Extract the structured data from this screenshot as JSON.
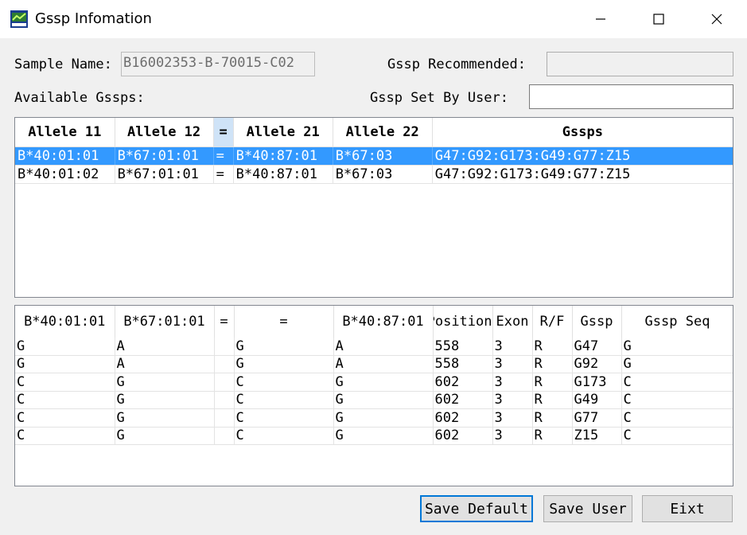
{
  "window": {
    "title": "Gssp Infomation",
    "controls": {
      "minimize": "—",
      "maximize": "☐",
      "close": "✕"
    }
  },
  "labels": {
    "sample_name": "Sample Name:",
    "gssp_recommended": "Gssp Recommended:",
    "available_gssps": "Available Gssps:",
    "gssp_set_by_user": "Gssp Set By User:"
  },
  "fields": {
    "sample_name_value": "B16002353-B-70015-C02",
    "gssp_recommended_value": "",
    "gssp_set_by_user_value": ""
  },
  "available_table": {
    "headers": [
      "Allele 11",
      "Allele 12",
      "=",
      "Allele 21",
      "Allele 22",
      "Gssps"
    ],
    "rows": [
      [
        "B*40:01:01",
        "B*67:01:01",
        "=",
        "B*40:87:01",
        "B*67:03",
        "G47:G92:G173:G49:G77:Z15"
      ],
      [
        "B*40:01:02",
        "B*67:01:01",
        "=",
        "B*40:87:01",
        "B*67:03",
        "G47:G92:G173:G49:G77:Z15"
      ]
    ],
    "selected_row": 0
  },
  "detail_table": {
    "headers": [
      "B*40:01:01",
      "B*67:01:01",
      "=",
      "=",
      "B*40:87:01",
      "Position",
      "Exon",
      "R/F",
      "Gssp",
      "Gssp Seq"
    ],
    "rows": [
      [
        "G",
        "A",
        "",
        "G",
        "A",
        "558",
        "3",
        "R",
        "G47",
        "G"
      ],
      [
        "G",
        "A",
        "",
        "G",
        "A",
        "558",
        "3",
        "R",
        "G92",
        "G"
      ],
      [
        "C",
        "G",
        "",
        "C",
        "G",
        "602",
        "3",
        "R",
        "G173",
        "C"
      ],
      [
        "C",
        "G",
        "",
        "C",
        "G",
        "602",
        "3",
        "R",
        "G49",
        "C"
      ],
      [
        "C",
        "G",
        "",
        "C",
        "G",
        "602",
        "3",
        "R",
        "G77",
        "C"
      ],
      [
        "C",
        "G",
        "",
        "C",
        "G",
        "602",
        "3",
        "R",
        "Z15",
        "C"
      ]
    ]
  },
  "buttons": {
    "save_default": "Save Default",
    "save_user": "Save User",
    "exit": "Eixt"
  },
  "colors": {
    "selection": "#3399ff",
    "default_button_border": "#0078d7"
  }
}
